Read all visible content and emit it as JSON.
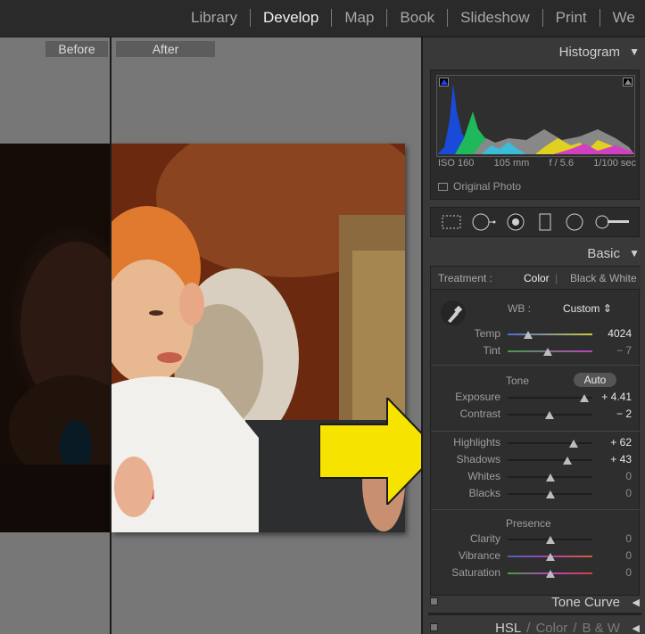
{
  "modules": [
    "Library",
    "Develop",
    "Map",
    "Book",
    "Slideshow",
    "Print",
    "We"
  ],
  "active_module": "Develop",
  "compare": {
    "before": "Before",
    "after": "After"
  },
  "histogram": {
    "title": "Histogram",
    "iso": "ISO 160",
    "focal": "105 mm",
    "aperture": "f / 5.6",
    "shutter": "1/100 sec",
    "original_photo": "Original Photo"
  },
  "basic": {
    "title": "Basic",
    "treatment_label": "Treatment :",
    "color": "Color",
    "bw": "Black & White",
    "wb_label": "WB :",
    "wb_value": "Custom",
    "wb_arrow": "⇕",
    "tone_label": "Tone",
    "auto": "Auto",
    "presence_label": "Presence",
    "sliders": {
      "temp": {
        "label": "Temp",
        "value": "4024",
        "pos": 0.24
      },
      "tint": {
        "label": "Tint",
        "value": "− 7",
        "pos": 0.47
      },
      "exposure": {
        "label": "Exposure",
        "value": "+ 4.41",
        "pos": 0.91
      },
      "contrast": {
        "label": "Contrast",
        "value": "− 2",
        "pos": 0.49
      },
      "highlights": {
        "label": "Highlights",
        "value": "+ 62",
        "pos": 0.78
      },
      "shadows": {
        "label": "Shadows",
        "value": "+ 43",
        "pos": 0.7
      },
      "whites": {
        "label": "Whites",
        "value": "0",
        "pos": 0.5
      },
      "blacks": {
        "label": "Blacks",
        "value": "0",
        "pos": 0.5
      },
      "clarity": {
        "label": "Clarity",
        "value": "0",
        "pos": 0.5
      },
      "vibrance": {
        "label": "Vibrance",
        "value": "0",
        "pos": 0.5
      },
      "saturation": {
        "label": "Saturation",
        "value": "0",
        "pos": 0.5
      }
    }
  },
  "tone_curve": "Tone Curve",
  "hsl_tabs": [
    "HSL",
    "/",
    "Color",
    "/",
    "B & W"
  ],
  "colors": {
    "accent_yellow": "#f7e300",
    "panel_bg": "#393939",
    "main_bg": "#777777"
  }
}
